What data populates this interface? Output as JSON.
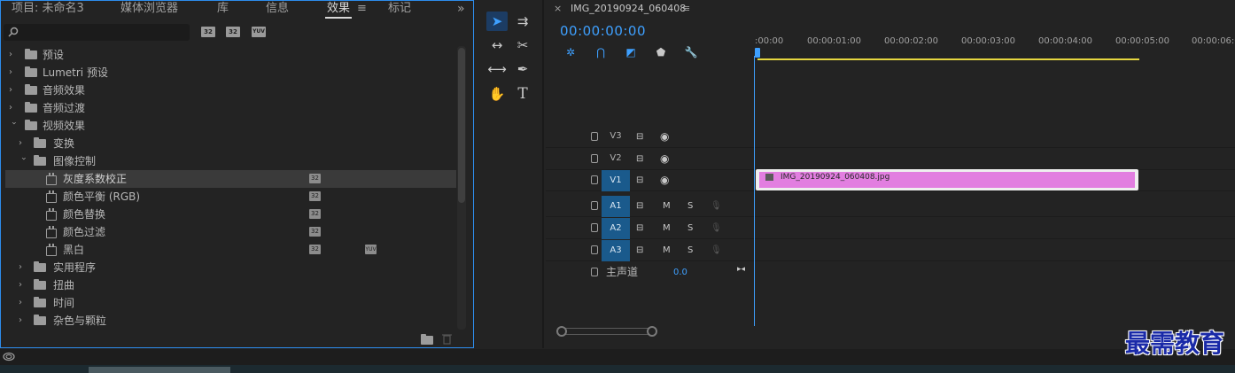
{
  "project_panel": {
    "tabs": [
      {
        "label": "项目: 未命名3"
      },
      {
        "label": "媒体浏览器"
      },
      {
        "label": "库"
      },
      {
        "label": "信息"
      },
      {
        "label": "效果"
      },
      {
        "label": "标记"
      }
    ],
    "menu_glyph": "≡",
    "overflow_glyph": "»",
    "search": {
      "value": "",
      "placeholder": ""
    },
    "filter_buttons": [
      {
        "label": "32",
        "icon": "accelerated-effects-icon"
      },
      {
        "label": "32",
        "icon": "32bit-color-icon"
      },
      {
        "label": "YUV",
        "icon": "yuv-effects-icon"
      }
    ],
    "tree": [
      {
        "label": "预设",
        "type": "preset-folder",
        "expanded": false
      },
      {
        "label": "Lumetri 预设",
        "type": "preset-folder",
        "expanded": false
      },
      {
        "label": "音频效果",
        "type": "folder",
        "expanded": false
      },
      {
        "label": "音频过渡",
        "type": "folder",
        "expanded": false
      },
      {
        "label": "视频效果",
        "type": "folder",
        "expanded": true
      },
      {
        "label": "变换",
        "type": "folder",
        "expanded": false
      },
      {
        "label": "图像控制",
        "type": "folder",
        "expanded": true
      },
      {
        "label": "灰度系数校正",
        "type": "effect",
        "selected": true
      },
      {
        "label": "颜色平衡 (RGB)",
        "type": "effect"
      },
      {
        "label": "颜色替换",
        "type": "effect"
      },
      {
        "label": "颜色过滤",
        "type": "effect"
      },
      {
        "label": "黑白",
        "type": "effect"
      },
      {
        "label": "实用程序",
        "type": "folder",
        "expanded": false
      },
      {
        "label": "扭曲",
        "type": "folder",
        "expanded": false
      },
      {
        "label": "时间",
        "type": "folder",
        "expanded": false
      },
      {
        "label": "杂色与颗粒",
        "type": "folder",
        "expanded": false
      }
    ],
    "badge_text": "32",
    "yuv_text": "YUV"
  },
  "tools": [
    {
      "name": "selection-tool",
      "glyph": "➤",
      "active": true
    },
    {
      "name": "track-select-tool",
      "glyph": "⇉"
    },
    {
      "name": "ripple-edit-tool",
      "glyph": "↔"
    },
    {
      "name": "razor-tool",
      "glyph": "✂"
    },
    {
      "name": "slip-tool",
      "glyph": "⟷"
    },
    {
      "name": "pen-tool",
      "glyph": "✒"
    },
    {
      "name": "hand-tool",
      "glyph": "✋"
    },
    {
      "name": "type-tool",
      "glyph": "T"
    }
  ],
  "timeline": {
    "close_glyph": "×",
    "sequence_name": "IMG_20190924_060408",
    "menu_glyph": "≡",
    "timecode": "00:00:00:00",
    "ruler": [
      ":00:00",
      "00:00:01:00",
      "00:00:02:00",
      "00:00:03:00",
      "00:00:04:00",
      "00:00:05:00",
      "00:00:06:00"
    ],
    "video_tracks": [
      {
        "name": "V3",
        "targeted": false
      },
      {
        "name": "V2",
        "targeted": false
      },
      {
        "name": "V1",
        "targeted": true
      }
    ],
    "audio_tracks": [
      {
        "name": "A1",
        "mute": "M",
        "solo": "S"
      },
      {
        "name": "A2",
        "mute": "M",
        "solo": "S"
      },
      {
        "name": "A3",
        "mute": "M",
        "solo": "S"
      }
    ],
    "master": {
      "label": "主声道",
      "value": "0.0"
    },
    "clip": {
      "label": "IMG_20190924_060408.jpg",
      "color": "#e27ee0"
    }
  },
  "watermark": "最需教育",
  "colors": {
    "accent": "#3ea0ff",
    "panel_border": "#2d8ceb",
    "clip": "#e27ee0",
    "work_area": "#e6d740"
  }
}
